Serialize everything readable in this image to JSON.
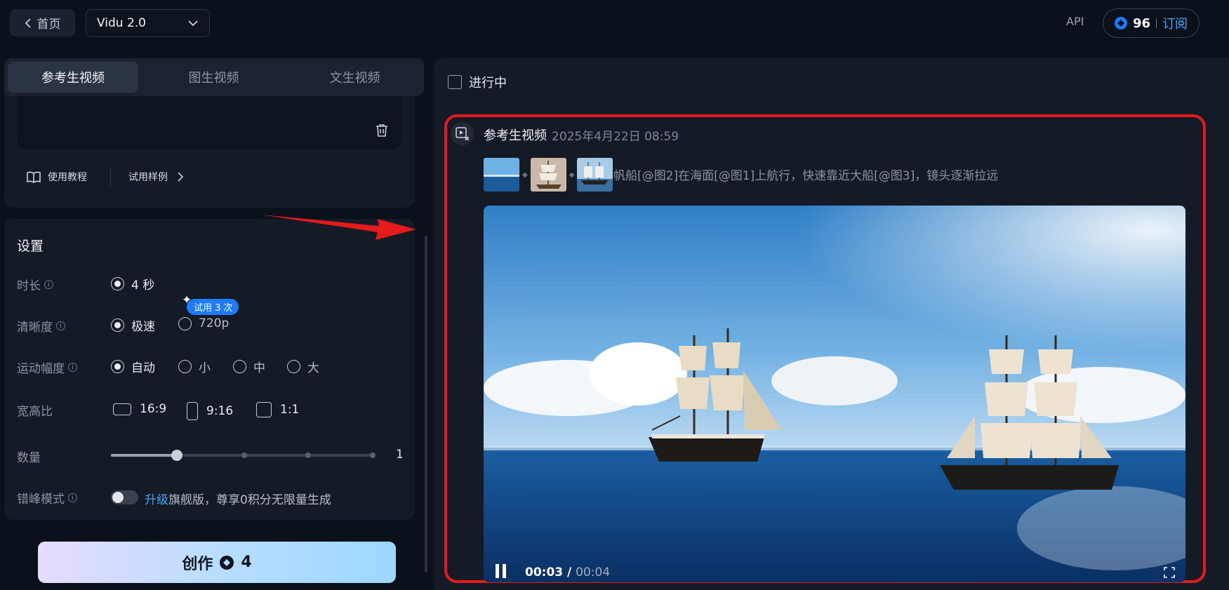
{
  "topbar": {
    "home_label": "首页",
    "model_value": "Vidu 2.0",
    "api_label": "API",
    "credits": "96",
    "subscribe_label": "订阅"
  },
  "tabs": [
    {
      "label": "参考生视频",
      "active": true
    },
    {
      "label": "图生视频",
      "active": false
    },
    {
      "label": "文生视频",
      "active": false
    }
  ],
  "prompt_panel": {
    "tutorial_label": "使用教程",
    "examples_label": "试用样例"
  },
  "settings": {
    "title": "设置",
    "duration": {
      "label": "时长",
      "options": [
        "4 秒"
      ],
      "selected": "4 秒"
    },
    "resolution": {
      "label": "清晰度",
      "options": [
        "极速",
        "720p"
      ],
      "selected": "极速",
      "badge": "试用 3 次"
    },
    "motion": {
      "label": "运动幅度",
      "options": [
        "自动",
        "小",
        "中",
        "大"
      ],
      "selected": "自动"
    },
    "aspect": {
      "label": "宽高比",
      "options": [
        "16:9",
        "9:16",
        "1:1"
      ]
    },
    "quantity": {
      "label": "数量",
      "value": "1",
      "fraction": 0.25
    },
    "offpeak": {
      "label": "错峰模式",
      "upgrade": "升级",
      "text": "旗舰版，尊享0积分无限量生成",
      "enabled": false
    }
  },
  "create": {
    "label": "创作",
    "cost": "4"
  },
  "results": {
    "filter_label": "进行中",
    "card": {
      "title": "参考生视频",
      "time": "2025年4月22日 08:59",
      "prompt": "帆船[@图2]在海面[@图1]上航行，快速靠近大船[@图3]，镜头逐渐拉远"
    },
    "video": {
      "current": "00:03",
      "separator": " / ",
      "total": "00:04",
      "progress": 0.75
    }
  },
  "colors": {
    "accent": "#1e7bff",
    "link": "#3da8ff",
    "highlight": "#e51b1b"
  }
}
